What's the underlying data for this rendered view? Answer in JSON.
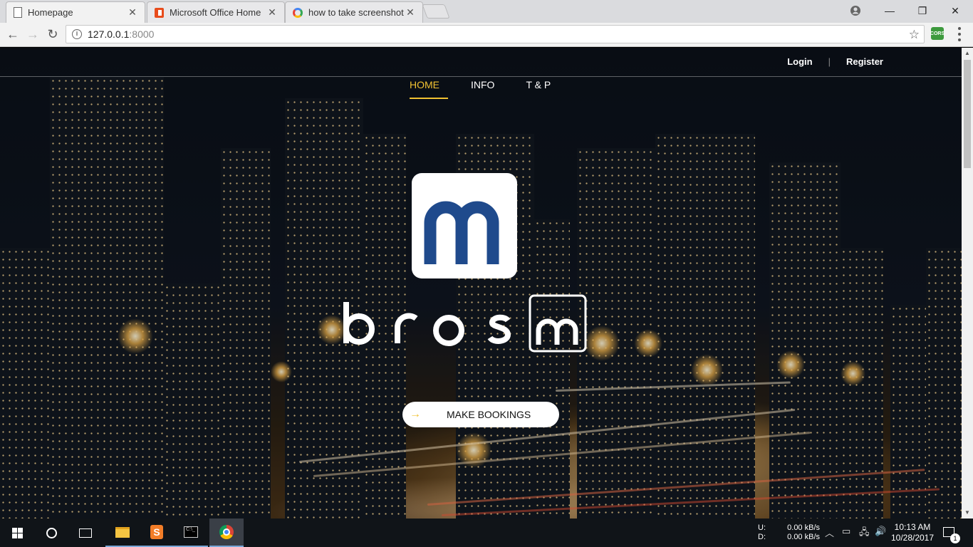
{
  "browser": {
    "tabs": [
      {
        "title": "Homepage",
        "icon": "page-icon",
        "active": true
      },
      {
        "title": "Microsoft Office Home",
        "icon": "office-icon",
        "active": false
      },
      {
        "title": "how to take screenshot o",
        "icon": "google-icon",
        "active": false
      }
    ],
    "url_host": "127.0.0.1",
    "url_port": ":8000",
    "extension_label": "CORS"
  },
  "site": {
    "auth": {
      "login": "Login",
      "separator": "|",
      "register": "Register"
    },
    "nav": [
      {
        "label": "HOME",
        "active": true
      },
      {
        "label": "INFO",
        "active": false
      },
      {
        "label": "T & P",
        "active": false
      }
    ],
    "logo_letter": "m",
    "wordmark": {
      "letters": "bros",
      "boxed_letter": "m"
    },
    "cta": {
      "arrow": "→",
      "label": "MAKE BOOKINGS"
    },
    "accent_color": "#f1c232",
    "logo_color": "#1f4a8c"
  },
  "taskbar": {
    "net_labels": {
      "up": "U:",
      "down": "D:"
    },
    "net_values": {
      "up": "0.00 kB/s",
      "down": "0.00 kB/s"
    },
    "time": "10:13 AM",
    "date": "10/28/2017",
    "notification_count": "1"
  }
}
